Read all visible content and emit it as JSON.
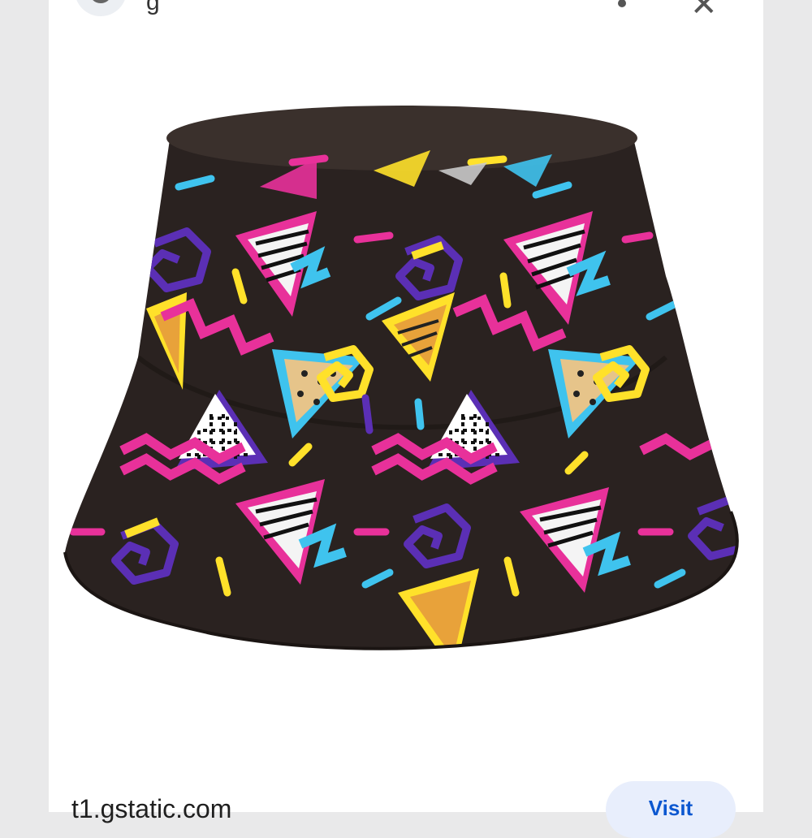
{
  "header": {
    "title_fragment": "g",
    "more_icon": "more-vert-icon",
    "close_icon": "close-icon",
    "close_glyph": "✕"
  },
  "image": {
    "subject": "bucket-hat-with-retro-pattern",
    "colors": {
      "base": "#2a2220",
      "magenta": "#e8319a",
      "cyan": "#3fc3ee",
      "yellow": "#ffe12a",
      "purple": "#5b2fb5",
      "orange": "#e8a23a"
    }
  },
  "footer": {
    "source": "t1.gstatic.com",
    "visit_label": "Visit"
  }
}
